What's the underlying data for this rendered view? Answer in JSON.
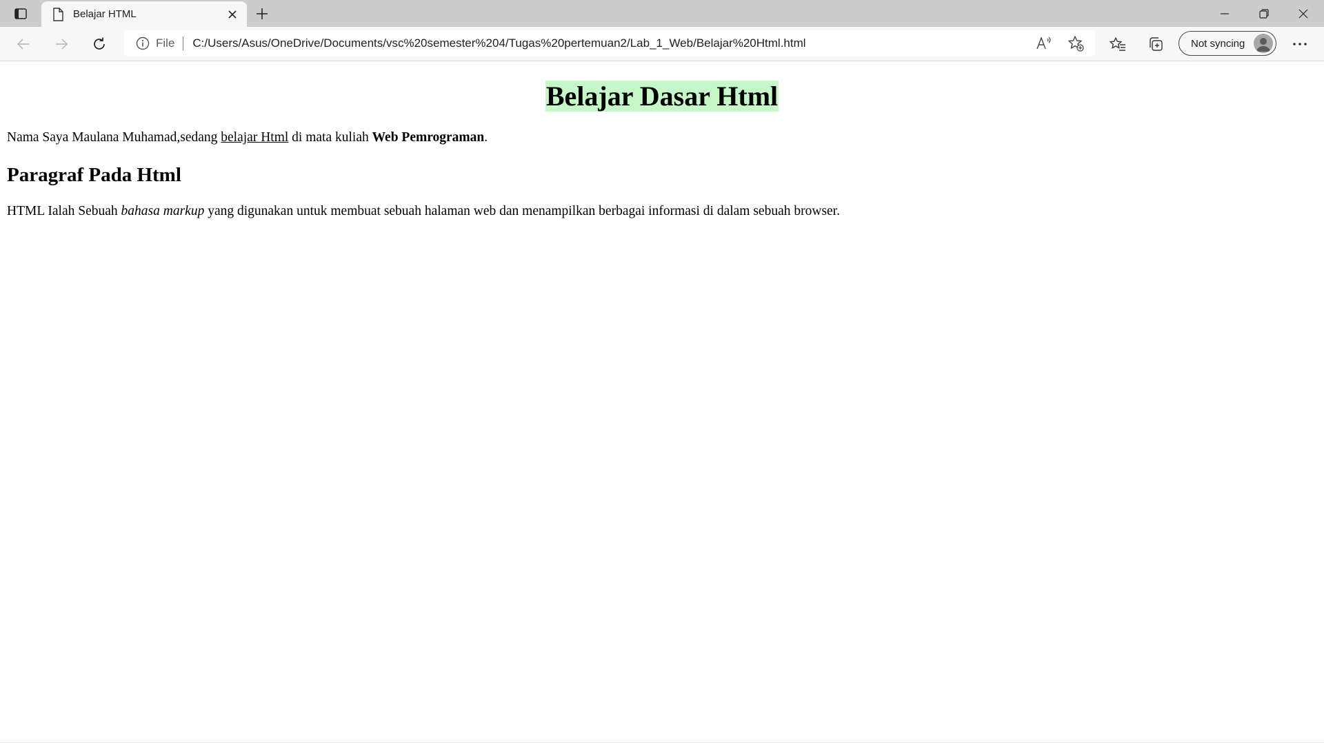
{
  "browser": {
    "tab": {
      "title": "Belajar HTML"
    },
    "address": {
      "scheme": "File",
      "url": "C:/Users/Asus/OneDrive/Documents/vsc%20semester%204/Tugas%20pertemuan2/Lab_1_Web/Belajar%20Html.html"
    },
    "profile": {
      "sync_label": "Not syncing"
    },
    "icons": {
      "tab_actions": "tab-actions-icon",
      "favicon": "page-icon",
      "tab_close": "close-icon",
      "new_tab": "plus-icon",
      "back": "back-arrow-icon",
      "forward": "forward-arrow-icon",
      "refresh": "refresh-icon",
      "site_info": "info-icon",
      "read_aloud": "read-aloud-icon",
      "add_favorite": "add-favorite-icon",
      "favorites": "favorites-icon",
      "collections": "collections-icon",
      "more": "more-icon",
      "minimize": "minimize-icon",
      "restore": "restore-icon",
      "close_window": "close-icon"
    }
  },
  "page": {
    "heading": "Belajar Dasar Html",
    "heading_highlight_color": "#c5f7c9",
    "intro": {
      "before": "Nama Saya Maulana Muhamad,sedang ",
      "link": "belajar Html",
      "middle": " di mata kuliah ",
      "bold": "Web Pemrograman",
      "after": "."
    },
    "subheading": "Paragraf Pada Html",
    "paragraph": {
      "before": "HTML Ialah Sebuah ",
      "italic": "bahasa markup",
      "after": " yang digunakan untuk membuat sebuah halaman web dan menampilkan berbagai informasi di dalam sebuah browser."
    }
  }
}
